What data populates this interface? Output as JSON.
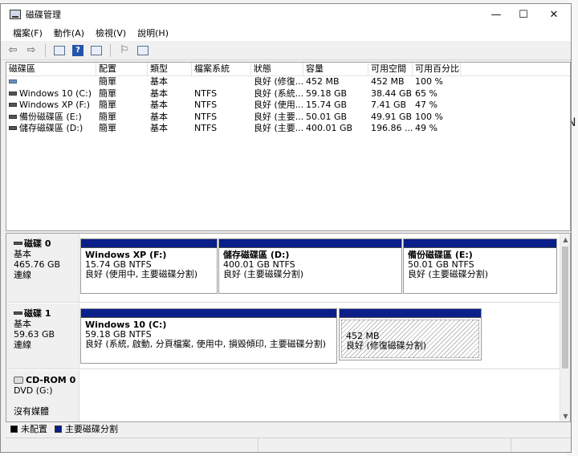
{
  "window": {
    "title": "磁碟管理",
    "controls": {
      "minimize": "—",
      "maximize": "☐",
      "close": "✕"
    }
  },
  "menu": [
    "檔案(F)",
    "動作(A)",
    "檢視(V)",
    "說明(H)"
  ],
  "toolbar": {
    "icons": [
      "back-icon",
      "forward-icon",
      "console-tree-icon",
      "help-icon",
      "properties-icon",
      "connect-icon",
      "settings-icon"
    ]
  },
  "volume_list": {
    "columns": [
      "磁碟區",
      "配置",
      "類型",
      "檔案系統",
      "狀態",
      "容量",
      "可用空間",
      "可用百分比"
    ],
    "rows": [
      {
        "name": "",
        "layout": "簡單",
        "type": "基本",
        "fs": "",
        "status": "良好 (修復...",
        "capacity": "452 MB",
        "free": "452 MB",
        "pct": "100 %"
      },
      {
        "name": "Windows 10 (C:)",
        "layout": "簡單",
        "type": "基本",
        "fs": "NTFS",
        "status": "良好 (系統...",
        "capacity": "59.18 GB",
        "free": "38.44 GB",
        "pct": "65 %"
      },
      {
        "name": "Windows XP (F:)",
        "layout": "簡單",
        "type": "基本",
        "fs": "NTFS",
        "status": "良好 (使用...",
        "capacity": "15.74 GB",
        "free": "7.41 GB",
        "pct": "47 %"
      },
      {
        "name": "備份磁碟區 (E:)",
        "layout": "簡單",
        "type": "基本",
        "fs": "NTFS",
        "status": "良好 (主要...",
        "capacity": "50.01 GB",
        "free": "49.91 GB",
        "pct": "100 %"
      },
      {
        "name": "儲存磁碟區 (D:)",
        "layout": "簡單",
        "type": "基本",
        "fs": "NTFS",
        "status": "良好 (主要...",
        "capacity": "400.01 GB",
        "free": "196.86 ...",
        "pct": "49 %"
      }
    ]
  },
  "disks": [
    {
      "name": "磁碟 0",
      "kind": "基本",
      "size": "465.76 GB",
      "state": "連線",
      "partitions": [
        {
          "name": "Windows XP  (F:)",
          "size": "15.74 GB NTFS",
          "status": "良好 (使用中, 主要磁碟分割)"
        },
        {
          "name": "儲存磁碟區  (D:)",
          "size": "400.01 GB NTFS",
          "status": "良好 (主要磁碟分割)"
        },
        {
          "name": "備份磁碟區  (E:)",
          "size": "50.01 GB NTFS",
          "status": "良好 (主要磁碟分割)"
        }
      ]
    },
    {
      "name": "磁碟 1",
      "kind": "基本",
      "size": "59.63 GB",
      "state": "連線",
      "partitions": [
        {
          "name": "Windows 10  (C:)",
          "size": "59.18 GB NTFS",
          "status": "良好 (系統, 啟動, 分頁檔案, 使用中, 損毀傾印, 主要磁碟分割)"
        },
        {
          "name": "",
          "size": "452 MB",
          "status": "良好 (修復磁碟分割)"
        }
      ]
    },
    {
      "name": "CD-ROM 0",
      "kind": "DVD (G:)",
      "size": "",
      "state": "沒有媒體"
    }
  ],
  "legend": [
    {
      "label": "未配置",
      "color": "#000000"
    },
    {
      "label": "主要磁碟分割",
      "color": "#0a1f8a"
    }
  ],
  "colors": {
    "primary_partition": "#0a1f8a",
    "unallocated": "#000000",
    "selection": "#cce8ff"
  }
}
